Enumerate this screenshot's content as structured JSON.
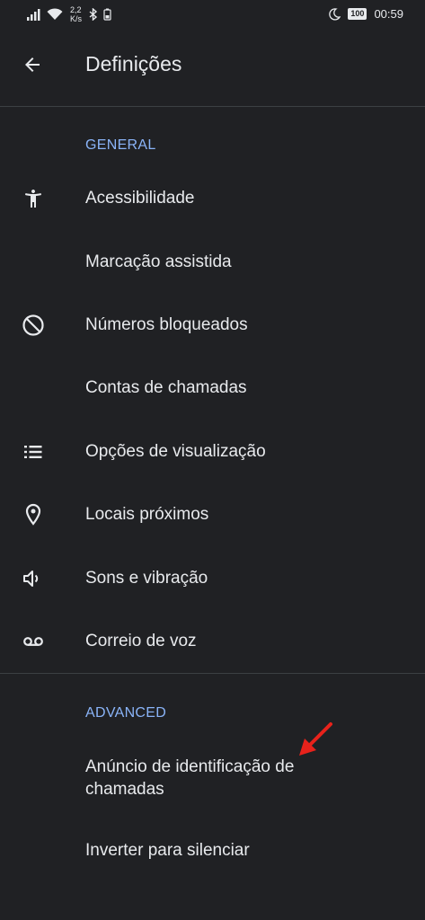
{
  "status_bar": {
    "speed_value": "2,2",
    "speed_unit": "K/s",
    "battery": "100",
    "time": "00:59"
  },
  "app_bar": {
    "title": "Definições"
  },
  "sections": {
    "general": {
      "header": "GENERAL",
      "items": [
        {
          "label": "Acessibilidade",
          "icon": "accessibility-icon"
        },
        {
          "label": "Marcação assistida",
          "icon": ""
        },
        {
          "label": "Números bloqueados",
          "icon": "block-icon"
        },
        {
          "label": "Contas de chamadas",
          "icon": ""
        },
        {
          "label": "Opções de visualização",
          "icon": "list-icon"
        },
        {
          "label": "Locais próximos",
          "icon": "location-pin-icon"
        },
        {
          "label": "Sons e vibração",
          "icon": "volume-icon"
        },
        {
          "label": "Correio de voz",
          "icon": "voicemail-icon"
        }
      ]
    },
    "advanced": {
      "header": "ADVANCED",
      "items": [
        {
          "label": "Anúncio de identificação de chamadas"
        },
        {
          "label": "Inverter para silenciar"
        }
      ]
    }
  },
  "annotation": {
    "arrow_color": "#e8221b"
  },
  "colors": {
    "background": "#202124",
    "text": "#e8eaed",
    "accent": "#8ab4f8",
    "divider": "#3c4043"
  }
}
